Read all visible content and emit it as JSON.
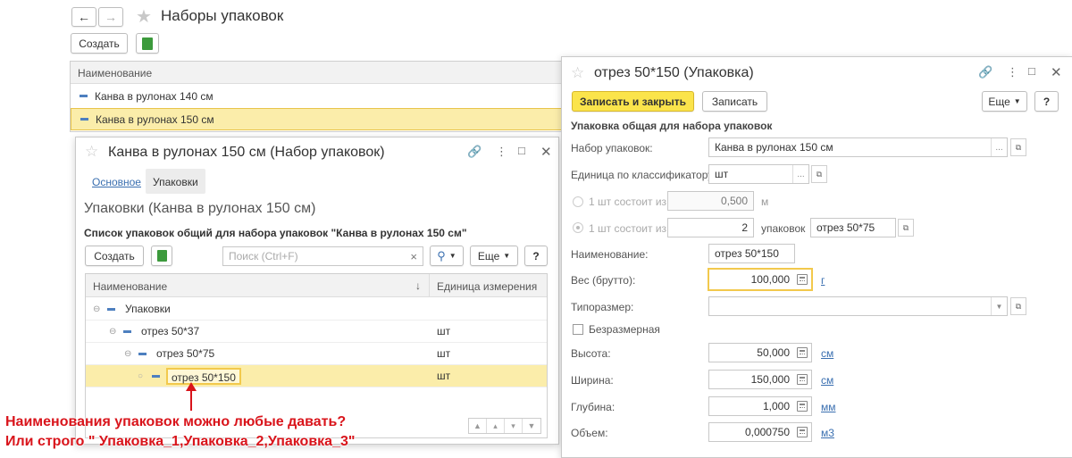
{
  "main": {
    "title": "Наборы упаковок",
    "create_label": "Создать",
    "col_name": "Наименование",
    "rows": [
      "Канва в рулонах 140 см",
      "Канва в рулонах 150 см"
    ]
  },
  "set_window": {
    "title": "Канва в рулонах 150 см (Набор упаковок)",
    "tab_main": "Основное",
    "tab_packages": "Упаковки",
    "section_title": "Упаковки (Канва в рулонах 150 см)",
    "list_title": "Список упаковок общий для набора упаковок \"Канва в рулонах 150 см\"",
    "create_label": "Создать",
    "search_placeholder": "Поиск (Ctrl+F)",
    "search_clear": "×",
    "more_label": "Еще",
    "help_label": "?",
    "col_name": "Наименование",
    "col_sort": "↓",
    "col_unit": "Единица измерения",
    "tree": [
      {
        "name": "Упаковки",
        "unit": ""
      },
      {
        "name": "отрез 50*37",
        "unit": "шт"
      },
      {
        "name": "отрез 50*75",
        "unit": "шт"
      },
      {
        "name": "отрез 50*150",
        "unit": "шт"
      }
    ]
  },
  "pkg_window": {
    "title": "отрез 50*150 (Упаковка)",
    "save_close_label": "Записать и закрыть",
    "save_label": "Записать",
    "more_label": "Еще",
    "help_label": "?",
    "section_title": "Упаковка общая для набора упаковок",
    "set_label": "Набор упаковок:",
    "set_value": "Канва в рулонах 150 см",
    "unit_label": "Единица по классификатору:",
    "unit_value": "шт",
    "consists1_label": "1 шт состоит из",
    "consists1_value": "0,500",
    "consists1_unit": "м",
    "consists2_label": "1 шт состоит из",
    "consists2_value": "2",
    "consists2_unit": "упаковок",
    "consists2_pkg": "отрез 50*75",
    "name_label": "Наименование:",
    "name_value": "отрез 50*150",
    "weight_label": "Вес (брутто):",
    "weight_value": "100,000",
    "weight_unit": "г",
    "size_label": "Типоразмер:",
    "size_value": "",
    "dimensionless_label": "Безразмерная",
    "height_label": "Высота:",
    "height_value": "50,000",
    "height_unit": "см",
    "width_label": "Ширина:",
    "width_value": "150,000",
    "width_unit": "см",
    "depth_label": "Глубина:",
    "depth_value": "1,000",
    "depth_unit": "мм",
    "volume_label": "Объем:",
    "volume_value": "0,000750",
    "volume_unit": "м3"
  },
  "annotation": {
    "line1": "Наименования упаковок можно любые давать?",
    "line2": "Или строго \" Упаковка_1,Упаковка_2,Упаковка_3\""
  },
  "colors": {
    "accent_yellow": "#fbe44b",
    "selection_row": "#fbedaa",
    "annotation_red": "#d9141b",
    "link_blue": "#3a6fb0"
  }
}
